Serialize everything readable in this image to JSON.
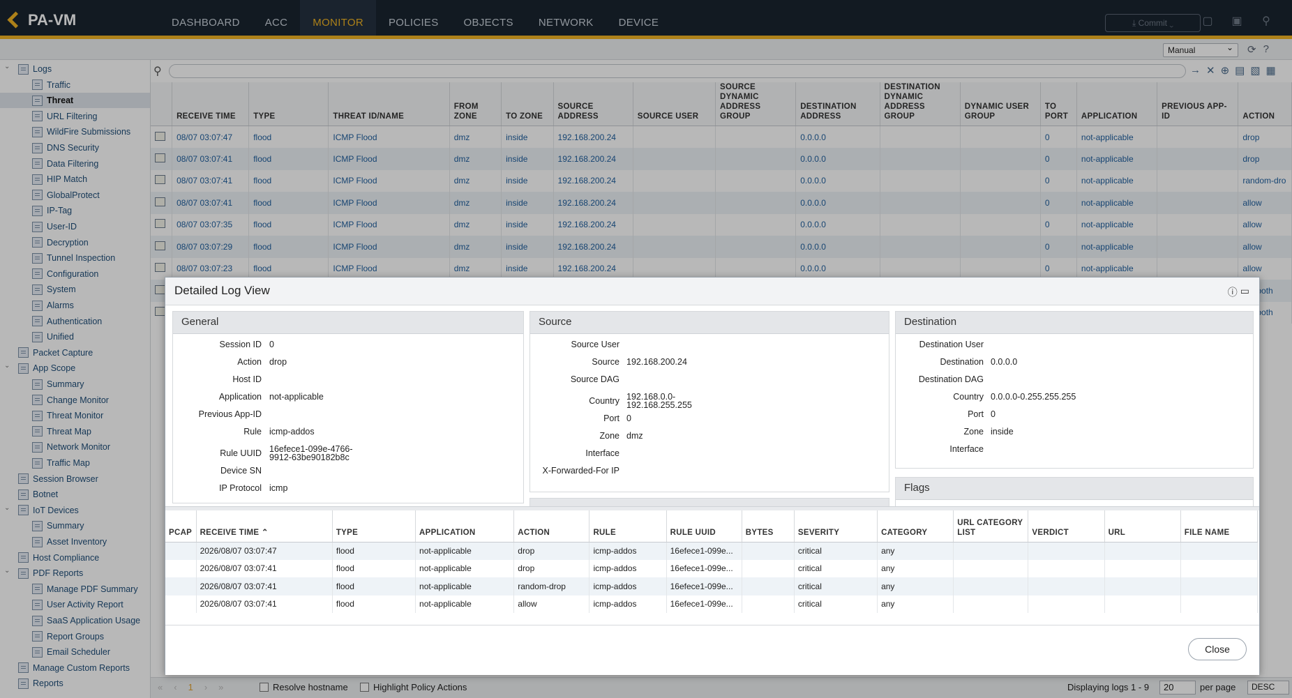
{
  "app": {
    "logo": "PA-VM",
    "commit_label": "Commit"
  },
  "nav": [
    "DASHBOARD",
    "ACC",
    "MONITOR",
    "POLICIES",
    "OBJECTS",
    "NETWORK",
    "DEVICE"
  ],
  "toolbar": {
    "mode_select": "Manual"
  },
  "sidebar": {
    "items": [
      {
        "label": "Logs",
        "indent": 1
      },
      {
        "label": "Traffic",
        "indent": 2
      },
      {
        "label": "Threat",
        "indent": 2,
        "selected": true
      },
      {
        "label": "URL Filtering",
        "indent": 2
      },
      {
        "label": "WildFire Submissions",
        "indent": 2
      },
      {
        "label": "DNS Security",
        "indent": 2
      },
      {
        "label": "Data Filtering",
        "indent": 2
      },
      {
        "label": "HIP Match",
        "indent": 2
      },
      {
        "label": "GlobalProtect",
        "indent": 2
      },
      {
        "label": "IP-Tag",
        "indent": 2
      },
      {
        "label": "User-ID",
        "indent": 2
      },
      {
        "label": "Decryption",
        "indent": 2
      },
      {
        "label": "Tunnel Inspection",
        "indent": 2
      },
      {
        "label": "Configuration",
        "indent": 2
      },
      {
        "label": "System",
        "indent": 2
      },
      {
        "label": "Alarms",
        "indent": 2
      },
      {
        "label": "Authentication",
        "indent": 2
      },
      {
        "label": "Unified",
        "indent": 2
      },
      {
        "label": "Packet Capture",
        "indent": 1
      },
      {
        "label": "App Scope",
        "indent": 1
      },
      {
        "label": "Summary",
        "indent": 2
      },
      {
        "label": "Change Monitor",
        "indent": 2
      },
      {
        "label": "Threat Monitor",
        "indent": 2
      },
      {
        "label": "Threat Map",
        "indent": 2
      },
      {
        "label": "Network Monitor",
        "indent": 2
      },
      {
        "label": "Traffic Map",
        "indent": 2
      },
      {
        "label": "Session Browser",
        "indent": 1
      },
      {
        "label": "Botnet",
        "indent": 1
      },
      {
        "label": "IoT Devices",
        "indent": 1
      },
      {
        "label": "Summary",
        "indent": 2
      },
      {
        "label": "Asset Inventory",
        "indent": 2
      },
      {
        "label": "Host Compliance",
        "indent": 1
      },
      {
        "label": "PDF Reports",
        "indent": 1
      },
      {
        "label": "Manage PDF Summary",
        "indent": 2
      },
      {
        "label": "User Activity Report",
        "indent": 2
      },
      {
        "label": "SaaS Application Usage",
        "indent": 2
      },
      {
        "label": "Report Groups",
        "indent": 2
      },
      {
        "label": "Email Scheduler",
        "indent": 2
      },
      {
        "label": "Manage Custom Reports",
        "indent": 1
      },
      {
        "label": "Reports",
        "indent": 1
      }
    ]
  },
  "log_table": {
    "columns": [
      "",
      "RECEIVE TIME",
      "TYPE",
      "THREAT ID/NAME",
      "FROM ZONE",
      "TO ZONE",
      "SOURCE ADDRESS",
      "SOURCE USER",
      "SOURCE DYNAMIC ADDRESS GROUP",
      "DESTINATION ADDRESS",
      "DESTINATION DYNAMIC ADDRESS GROUP",
      "DYNAMIC USER GROUP",
      "TO PORT",
      "APPLICATION",
      "PREVIOUS APP-ID",
      "ACTION"
    ],
    "rows": [
      [
        "08/07 03:07:47",
        "flood",
        "ICMP Flood",
        "dmz",
        "inside",
        "192.168.200.24",
        "",
        "",
        "0.0.0.0",
        "",
        "",
        "0",
        "not-applicable",
        "",
        "drop"
      ],
      [
        "08/07 03:07:41",
        "flood",
        "ICMP Flood",
        "dmz",
        "inside",
        "192.168.200.24",
        "",
        "",
        "0.0.0.0",
        "",
        "",
        "0",
        "not-applicable",
        "",
        "drop"
      ],
      [
        "08/07 03:07:41",
        "flood",
        "ICMP Flood",
        "dmz",
        "inside",
        "192.168.200.24",
        "",
        "",
        "0.0.0.0",
        "",
        "",
        "0",
        "not-applicable",
        "",
        "random-dro"
      ],
      [
        "08/07 03:07:41",
        "flood",
        "ICMP Flood",
        "dmz",
        "inside",
        "192.168.200.24",
        "",
        "",
        "0.0.0.0",
        "",
        "",
        "0",
        "not-applicable",
        "",
        "allow"
      ],
      [
        "08/07 03:07:35",
        "flood",
        "ICMP Flood",
        "dmz",
        "inside",
        "192.168.200.24",
        "",
        "",
        "0.0.0.0",
        "",
        "",
        "0",
        "not-applicable",
        "",
        "allow"
      ],
      [
        "08/07 03:07:29",
        "flood",
        "ICMP Flood",
        "dmz",
        "inside",
        "192.168.200.24",
        "",
        "",
        "0.0.0.0",
        "",
        "",
        "0",
        "not-applicable",
        "",
        "allow"
      ],
      [
        "08/07 03:07:23",
        "flood",
        "ICMP Flood",
        "dmz",
        "inside",
        "192.168.200.24",
        "",
        "",
        "0.0.0.0",
        "",
        "",
        "0",
        "not-applicable",
        "",
        "allow"
      ],
      [
        "",
        "",
        "",
        "",
        "",
        "",
        "",
        "",
        "",
        "",
        "",
        "",
        "",
        "",
        "set-both"
      ],
      [
        "",
        "",
        "",
        "",
        "",
        "",
        "",
        "",
        "",
        "",
        "",
        "",
        "",
        "",
        "set-both"
      ]
    ]
  },
  "bottom": {
    "page": "1",
    "resolve_hostname": "Resolve hostname",
    "highlight_policy": "Highlight Policy Actions",
    "displaying": "Displaying logs 1 - 9",
    "per_page_value": "20",
    "per_page_label": "per page",
    "sort": "DESC"
  },
  "modal": {
    "title": "Detailed Log View",
    "general": {
      "title": "General",
      "fields": [
        {
          "k": "Session ID",
          "v": "0"
        },
        {
          "k": "Action",
          "v": "drop"
        },
        {
          "k": "Host ID",
          "v": ""
        },
        {
          "k": "Application",
          "v": "not-applicable"
        },
        {
          "k": "Previous App-ID",
          "v": ""
        },
        {
          "k": "Rule",
          "v": "icmp-addos"
        },
        {
          "k": "Rule UUID",
          "v": "16efece1-099e-4766-\n9912-63be90182b8c"
        },
        {
          "k": "Device SN",
          "v": ""
        },
        {
          "k": "IP Protocol",
          "v": "icmp"
        }
      ]
    },
    "source": {
      "title": "Source",
      "fields": [
        {
          "k": "Source User",
          "v": ""
        },
        {
          "k": "Source",
          "v": "192.168.200.24"
        },
        {
          "k": "Source DAG",
          "v": ""
        },
        {
          "k": "Country",
          "v": "192.168.0.0-\n192.168.255.255"
        },
        {
          "k": "Port",
          "v": "0"
        },
        {
          "k": "Zone",
          "v": "dmz"
        },
        {
          "k": "Interface",
          "v": ""
        },
        {
          "k": "X-Forwarded-For IP",
          "v": ""
        }
      ]
    },
    "destination": {
      "title": "Destination",
      "fields": [
        {
          "k": "Destination User",
          "v": ""
        },
        {
          "k": "Destination",
          "v": "0.0.0.0"
        },
        {
          "k": "Destination DAG",
          "v": ""
        },
        {
          "k": "Country",
          "v": "0.0.0.0-0.255.255.255"
        },
        {
          "k": "Port",
          "v": "0"
        },
        {
          "k": "Zone",
          "v": "inside"
        },
        {
          "k": "Interface",
          "v": ""
        }
      ]
    },
    "flags": {
      "title": "Flags"
    },
    "related": {
      "columns": [
        "PCAP",
        "RECEIVE TIME",
        "TYPE",
        "APPLICATION",
        "ACTION",
        "RULE",
        "RULE UUID",
        "BYTES",
        "SEVERITY",
        "CATEGORY",
        "URL CATEGORY LIST",
        "VERDICT",
        "URL",
        "FILE NAME"
      ],
      "rows": [
        [
          "",
          "2026/08/07 03:07:47",
          "flood",
          "not-applicable",
          "drop",
          "icmp-addos",
          "16efece1-099e...",
          "",
          "critical",
          "any",
          "",
          "",
          "",
          ""
        ],
        [
          "",
          "2026/08/07 03:07:41",
          "flood",
          "not-applicable",
          "drop",
          "icmp-addos",
          "16efece1-099e...",
          "",
          "critical",
          "any",
          "",
          "",
          "",
          ""
        ],
        [
          "",
          "2026/08/07 03:07:41",
          "flood",
          "not-applicable",
          "random-drop",
          "icmp-addos",
          "16efece1-099e...",
          "",
          "critical",
          "any",
          "",
          "",
          "",
          ""
        ],
        [
          "",
          "2026/08/07 03:07:41",
          "flood",
          "not-applicable",
          "allow",
          "icmp-addos",
          "16efece1-099e...",
          "",
          "critical",
          "any",
          "",
          "",
          "",
          ""
        ]
      ]
    },
    "close_label": "Close"
  }
}
